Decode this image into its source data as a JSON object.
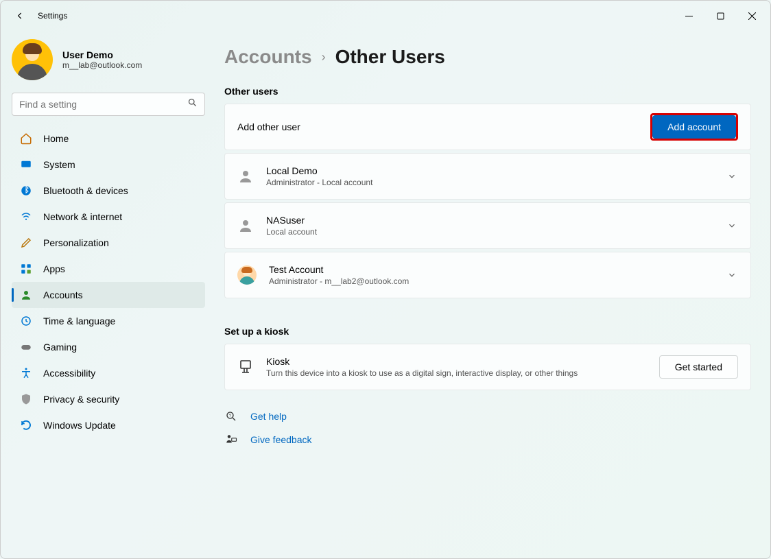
{
  "window": {
    "title": "Settings"
  },
  "profile": {
    "name": "User Demo",
    "email": "m__lab@outlook.com"
  },
  "search": {
    "placeholder": "Find a setting"
  },
  "nav": {
    "home": "Home",
    "system": "System",
    "bluetooth": "Bluetooth & devices",
    "network": "Network & internet",
    "personalization": "Personalization",
    "apps": "Apps",
    "accounts": "Accounts",
    "time": "Time & language",
    "gaming": "Gaming",
    "accessibility": "Accessibility",
    "privacy": "Privacy & security",
    "update": "Windows Update"
  },
  "breadcrumb": {
    "parent": "Accounts",
    "current": "Other Users"
  },
  "sections": {
    "other_users_title": "Other users",
    "add_other_user_label": "Add other user",
    "add_account_button": "Add account",
    "kiosk_title": "Set up a kiosk",
    "kiosk_name": "Kiosk",
    "kiosk_desc": "Turn this device into a kiosk to use as a digital sign, interactive display, or other things",
    "kiosk_button": "Get started"
  },
  "users": [
    {
      "name": "Local Demo",
      "detail": "Administrator - Local account"
    },
    {
      "name": "NASuser",
      "detail": "Local account"
    },
    {
      "name": "Test Account",
      "detail": "Administrator - m__lab2@outlook.com"
    }
  ],
  "footer": {
    "help": "Get help",
    "feedback": "Give feedback"
  }
}
